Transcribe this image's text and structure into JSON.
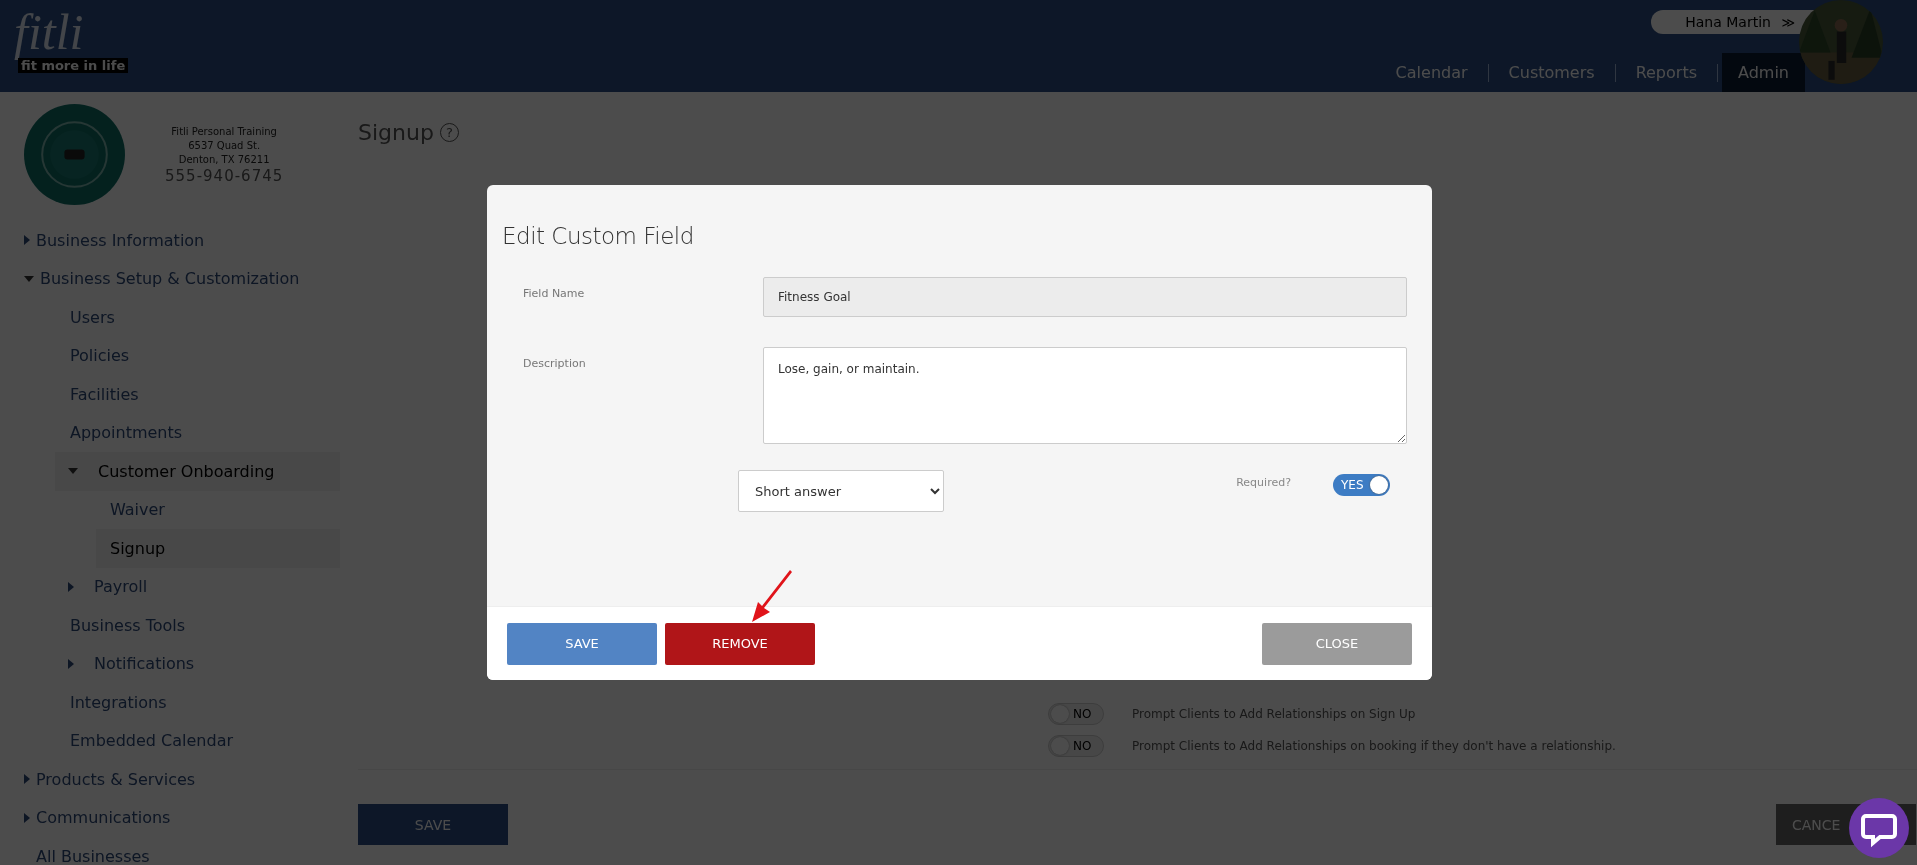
{
  "header": {
    "logo": "fitli",
    "tagline": "fit more in life",
    "user_name": "Hana Martin",
    "user_caret": "≫",
    "nav": [
      {
        "label": "Calendar",
        "selected": false
      },
      {
        "label": "Customers",
        "selected": false
      },
      {
        "label": "Reports",
        "selected": false
      },
      {
        "label": "Admin",
        "selected": true
      }
    ]
  },
  "business": {
    "name": "Fitli Personal Training",
    "street": "6537 Quad St.",
    "city": "Denton, TX 76211",
    "phone": "555-940-6745"
  },
  "sidebar": {
    "items": [
      {
        "label": "Business Information",
        "kind": "group",
        "expanded": false
      },
      {
        "label": "Business Setup & Customization",
        "kind": "group",
        "expanded": true,
        "children": [
          {
            "label": "Users",
            "kind": "link",
            "selected": false
          },
          {
            "label": "Policies",
            "kind": "link",
            "selected": false
          },
          {
            "label": "Facilities",
            "kind": "link",
            "selected": false
          },
          {
            "label": "Appointments",
            "kind": "link",
            "selected": false
          },
          {
            "label": "Customer Onboarding",
            "kind": "group",
            "expanded": true,
            "children": [
              {
                "label": "Waiver",
                "kind": "link",
                "selected": false
              },
              {
                "label": "Signup",
                "kind": "link",
                "selected": true
              }
            ]
          },
          {
            "label": "Payroll",
            "kind": "group",
            "expanded": false
          },
          {
            "label": "Business Tools",
            "kind": "link",
            "selected": false
          },
          {
            "label": "Notifications",
            "kind": "group",
            "expanded": false
          },
          {
            "label": "Integrations",
            "kind": "link",
            "selected": false
          },
          {
            "label": "Embedded Calendar",
            "kind": "link",
            "selected": false
          }
        ]
      },
      {
        "label": "Products & Services",
        "kind": "group",
        "expanded": false
      },
      {
        "label": "Communications",
        "kind": "group",
        "expanded": false
      },
      {
        "label": "All Businesses",
        "kind": "link",
        "selected": false
      }
    ]
  },
  "page": {
    "title": "Signup",
    "help": "?",
    "options": [
      {
        "on": false,
        "state": "NO",
        "label": "Prompt Clients to Add Relationships on Sign Up"
      },
      {
        "on": false,
        "state": "NO",
        "label": "Prompt Clients to Add Relationships on booking if they don't have a relationship."
      }
    ],
    "save": "SAVE",
    "cancel": "CANCE"
  },
  "modal": {
    "title": "Edit Custom Field",
    "field_name_label": "Field Name",
    "field_name": "Fitness Goal",
    "description_label": "Description",
    "description": "Lose, gain, or maintain.",
    "type": "Short answer",
    "required_label": "Required?",
    "required": {
      "on": true,
      "state": "YES"
    },
    "buttons": [
      {
        "label": "SAVE",
        "kind": "primary"
      },
      {
        "label": "REMOVE",
        "kind": "danger"
      },
      {
        "label": "CLOSE",
        "kind": "neutral"
      }
    ]
  }
}
